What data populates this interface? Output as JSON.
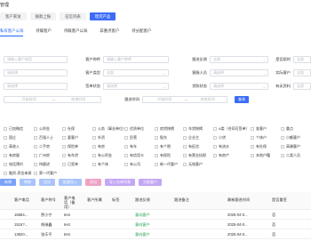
{
  "header": {
    "title": "管理"
  },
  "nav_tabs": [
    "客户来访",
    "拨款上报",
    "征信列表",
    "理贷产品"
  ],
  "sub_tabs": [
    "私有客户公海",
    "待联客户",
    "待联客户公海",
    "非重点客户",
    "待分配客户"
  ],
  "filters": {
    "row1": [
      {
        "label": "",
        "placeholder": "请输入客户电话"
      },
      {
        "label": "客户称呼",
        "placeholder": "请输入客户称呼"
      },
      {
        "label": "跟进反馈",
        "placeholder": "全部"
      },
      {
        "label": "是否超时",
        "placeholder": "全部"
      }
    ],
    "row2": [
      {
        "label": "",
        "placeholder": "请选择"
      },
      {
        "label": "客户类型",
        "placeholder": "全部"
      },
      {
        "label": "客服人员",
        "placeholder": "请选择"
      },
      {
        "label": "实际客户",
        "placeholder": "全部"
      }
    ],
    "row3": [
      {
        "label": "",
        "placeholder": "请选择"
      },
      {
        "label": "签单状态",
        "placeholder": "请选择"
      },
      {
        "label": "贷款状态",
        "placeholder": "请选择"
      },
      {
        "label": "有无资料",
        "placeholder": "全部"
      }
    ],
    "row4": {
      "range1": {
        "start": "开始时间",
        "end": "结束时间"
      },
      "label": "跟进时间",
      "range2": {
        "start": "开始时间",
        "end": "结束时间"
      },
      "search": "查询"
    }
  },
  "tags": [
    [
      "已加微信",
      "公积金",
      "社保",
      "公务（事业单位）",
      "优质单位",
      "房贷按揭",
      "车贷按揭",
      "A类（合同可签单）",
      "准客户",
      "重点"
    ],
    [
      "国企",
      "百强人士",
      "要客户",
      "外资",
      "民营",
      "股东",
      "企业主",
      "小贷",
      "个体户",
      "小额客户"
    ],
    [
      "高收入",
      "二手房",
      "保险单",
      "有房",
      "有车",
      "有个税",
      "有征信",
      "有流水",
      "有社保",
      "高端客户"
    ],
    [
      "有房屋",
      "广州房",
      "有车贷",
      "有公积金",
      "有信用卡",
      "有保险",
      "有营业执照",
      "有房产",
      "本地户籍",
      "二类人员"
    ],
    [
      "电话预约",
      "待跟进",
      "已签单",
      "有个体",
      "有公司",
      "新一代客户",
      "无效客户"
    ],
    [
      "融资-资金来源",
      "第一代客户"
    ]
  ],
  "action_buttons": [
    "新增",
    "转移",
    "回访",
    "批量导入",
    "导出",
    "导入名单列表",
    "分配客户"
  ],
  "table": {
    "columns": [
      "客户电话",
      "客户称号",
      "客户电话（备用）",
      "客户所属",
      "标签",
      "跟进反馈",
      "跟进备注",
      "最新跟进时间",
      "是否重签"
    ],
    "rows": [
      {
        "phone": "16884...",
        "name": "贾小宁",
        "source": "test",
        "feedback": "意向客户",
        "time": "2025-04-0...",
        "flag": "否"
      },
      {
        "phone": "1516?...",
        "name": "胡继鑫",
        "source": "test",
        "feedback": "意向客户",
        "time": "2025-04-0...",
        "flag": "否"
      },
      {
        "phone": "13820...",
        "name": "张乐平",
        "source": "test",
        "feedback": "意向客户",
        "time": "2025-04-0...",
        "flag": "否"
      }
    ]
  },
  "colors": {
    "primary": "#3b6cf6",
    "link_green": "#1e9e4f"
  }
}
